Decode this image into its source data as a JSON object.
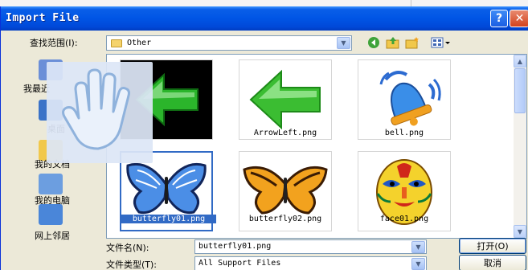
{
  "window": {
    "title": "Import File",
    "help_glyph": "?",
    "close_glyph": "✕"
  },
  "toolbar": {
    "look_in_label": "查找范围(I):",
    "look_in_value": "Other",
    "icons": [
      "back-icon",
      "up-folder-icon",
      "new-folder-icon",
      "view-menu-icon"
    ]
  },
  "places": [
    {
      "label": "我最近",
      "icon": "recent-documents-icon"
    },
    {
      "label": "桌面",
      "icon": "desktop-icon"
    },
    {
      "label": "我的文档",
      "icon": "my-documents-icon"
    },
    {
      "label": "我的电脑",
      "icon": "my-computer-icon"
    },
    {
      "label": "网上邻居",
      "icon": "network-places-icon"
    }
  ],
  "files": [
    {
      "name": "ArrowLeft2.gif",
      "visible_name": "wLeft2.gif"
    },
    {
      "name": "ArrowLeft.png"
    },
    {
      "name": "bell.png"
    },
    {
      "name": "butterfly01.png",
      "selected": true
    },
    {
      "name": "butterfly02.png"
    },
    {
      "name": "face01.png"
    }
  ],
  "filename": {
    "label": "文件名(N):",
    "value": "butterfly01.png"
  },
  "filetype": {
    "label": "文件类型(T):",
    "value": "All Support Files"
  },
  "buttons": {
    "open": "打开(O)",
    "cancel": "取消"
  },
  "overlay": {
    "icon": "hand-cursor-icon"
  },
  "colors": {
    "titlebar": "#0055e5",
    "selection": "#316ac5",
    "dialog_bg": "#ece9d8"
  }
}
